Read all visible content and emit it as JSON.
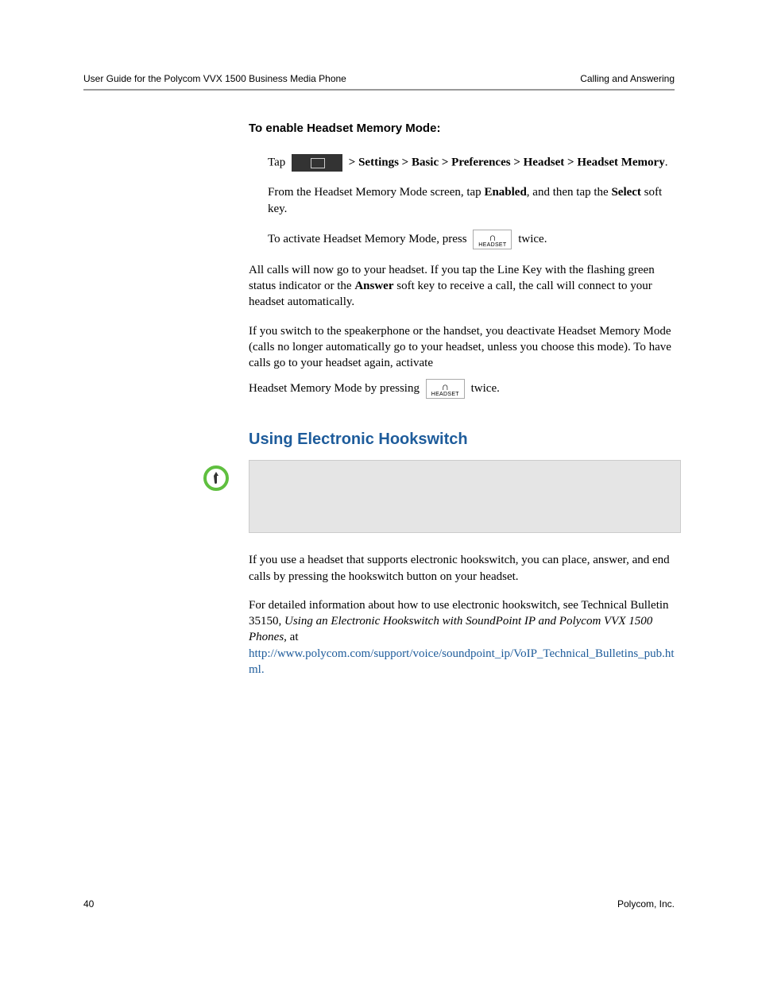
{
  "header": {
    "left": "User Guide for the Polycom VVX 1500 Business Media Phone",
    "right": "Calling and Answering"
  },
  "section1": {
    "title": "To enable Headset Memory Mode:",
    "tap": "Tap",
    "navpath": " > Settings > Basic > Preferences > Headset > Headset Memory",
    "period": ".",
    "p2a": "From the Headset Memory Mode screen, tap ",
    "p2b": "Enabled",
    "p2c": ", and then tap the ",
    "p2d": "Select",
    "p2e": " soft key.",
    "p3a": "To activate Headset Memory Mode, press ",
    "p3b": " twice.",
    "p4a": "All calls will now go to your headset. If you tap the Line Key with the flashing green status indicator or the ",
    "p4b": "Answer",
    "p4c": " soft key to receive a call, the call will connect to your headset automatically.",
    "p5": "If you switch to the speakerphone or the handset, you deactivate Headset Memory Mode (calls no longer automatically go to your headset, unless you choose this mode). To have calls go to your headset again, activate ",
    "p6a": "Headset Memory Mode by pressing ",
    "p6b": " twice."
  },
  "section2": {
    "title": "Using Electronic Hookswitch",
    "p1": "If you use a headset that supports electronic hookswitch, you can place, answer, and end calls by pressing the hookswitch button on your headset.",
    "p2a": "For detailed information about how to use electronic hookswitch, see Technical Bulletin 35150, ",
    "p2b": "Using an Electronic Hookswitch with SoundPoint IP and Polycom VVX 1500 Phones",
    "p2c": ", at",
    "link": "http://www.polycom.com/support/voice/soundpoint_ip/VoIP_Technical_Bulletins_pub.html."
  },
  "headset_button": {
    "label": "HEADSET"
  },
  "footer": {
    "page": "40",
    "company": "Polycom, Inc."
  }
}
